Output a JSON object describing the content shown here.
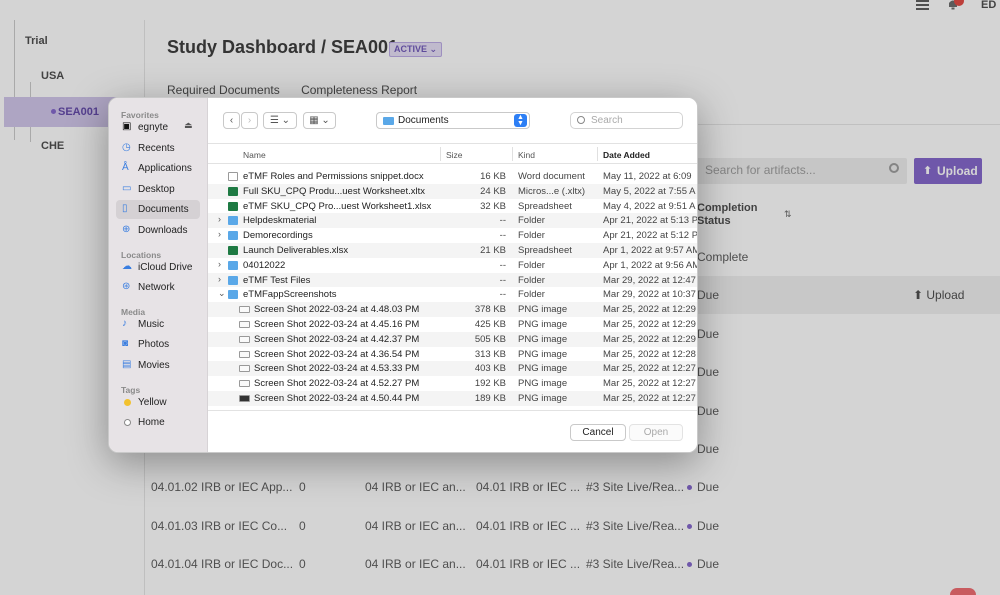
{
  "app": {
    "avatar": "ED",
    "title": "Study Dashboard / SEA001",
    "status": "ACTIVE",
    "tabs": [
      "Required Documents",
      "Completeness Report"
    ],
    "tree": {
      "root": "Trial",
      "country": "USA",
      "site": "SEA001",
      "other": "CHE"
    },
    "search_placeholder": "Search for artifacts...",
    "upload_label": "Upload",
    "column_header": "Completion Status",
    "rows": [
      {
        "status": "Complete",
        "kind": "ok"
      },
      {
        "status": "Due",
        "upload": "Upload",
        "highlight": true
      },
      {
        "status": "Due"
      },
      {
        "status": "Due"
      },
      {
        "status": "Due"
      },
      {
        "status": "Due"
      },
      {
        "c1": "04.01.02 IRB or IEC App...",
        "c2": "0",
        "c3": "04 IRB or IEC an...",
        "c4": "04.01 IRB or IEC ...",
        "c5": "#3 Site Live/Rea...",
        "status": "Due"
      },
      {
        "c1": "04.01.03 IRB or IEC Co...",
        "c2": "0",
        "c3": "04 IRB or IEC an...",
        "c4": "04.01 IRB or IEC ...",
        "c5": "#3 Site Live/Rea...",
        "status": "Due"
      },
      {
        "c1": "04.01.04 IRB or IEC Doc...",
        "c2": "0",
        "c3": "04 IRB or IEC an...",
        "c4": "04.01 IRB or IEC ...",
        "c5": "#3 Site Live/Rea...",
        "status": "Due"
      }
    ]
  },
  "dialog": {
    "sidebar": {
      "favorites_label": "Favorites",
      "favorites": [
        {
          "label": "egnyte",
          "icon": "drive-icon"
        },
        {
          "label": "Recents",
          "icon": "clock-icon"
        },
        {
          "label": "Applications",
          "icon": "apps-icon"
        },
        {
          "label": "Desktop",
          "icon": "desktop-icon"
        },
        {
          "label": "Documents",
          "icon": "document-icon",
          "active": true
        },
        {
          "label": "Downloads",
          "icon": "download-icon"
        }
      ],
      "locations_label": "Locations",
      "locations": [
        {
          "label": "iCloud Drive",
          "icon": "cloud-icon"
        },
        {
          "label": "Network",
          "icon": "globe-icon"
        }
      ],
      "media_label": "Media",
      "media": [
        {
          "label": "Music",
          "icon": "music-icon"
        },
        {
          "label": "Photos",
          "icon": "camera-icon"
        },
        {
          "label": "Movies",
          "icon": "film-icon"
        }
      ],
      "tags_label": "Tags",
      "tags": [
        {
          "label": "Yellow",
          "color": "#f2c12e"
        },
        {
          "label": "Home",
          "color": "#ffffff"
        }
      ]
    },
    "toolbar": {
      "back": "‹",
      "forward": "›",
      "list_view": "☰ ⌄",
      "grid_view": "▦ ⌄",
      "path": "Documents",
      "search_placeholder": "Search"
    },
    "columns": {
      "name": "Name",
      "size": "Size",
      "kind": "Kind",
      "date": "Date Added"
    },
    "files": [
      {
        "name": "eTMF Roles and Permissions snippet.docx",
        "size": "16 KB",
        "kind": "Word document",
        "date": "May 11, 2022 at 6:09",
        "icon": "doc"
      },
      {
        "name": "Full SKU_CPQ Produ...uest Worksheet.xltx",
        "size": "24 KB",
        "kind": "Micros...e (.xltx)",
        "date": "May 5, 2022 at 7:55 A",
        "icon": "xls"
      },
      {
        "name": "eTMF SKU_CPQ Pro...uest Worksheet1.xlsx",
        "size": "32 KB",
        "kind": "Spreadsheet",
        "date": "May 4, 2022 at 9:51 A",
        "icon": "xls"
      },
      {
        "name": "Helpdeskmaterial",
        "size": "--",
        "kind": "Folder",
        "date": "Apr 21, 2022 at 5:13 P",
        "icon": "folder",
        "disc": "›"
      },
      {
        "name": "Demorecordings",
        "size": "--",
        "kind": "Folder",
        "date": "Apr 21, 2022 at 5:12 P",
        "icon": "folder",
        "disc": "›"
      },
      {
        "name": "Launch Deliverables.xlsx",
        "size": "21 KB",
        "kind": "Spreadsheet",
        "date": "Apr 1, 2022 at 9:57 AM",
        "icon": "xls"
      },
      {
        "name": "04012022",
        "size": "--",
        "kind": "Folder",
        "date": "Apr 1, 2022 at 9:56 AM",
        "icon": "folder",
        "disc": "›"
      },
      {
        "name": "eTMF Test Files",
        "size": "--",
        "kind": "Folder",
        "date": "Mar 29, 2022 at 12:47",
        "icon": "folder",
        "disc": "›"
      },
      {
        "name": "eTMFappScreenshots",
        "size": "--",
        "kind": "Folder",
        "date": "Mar 29, 2022 at 10:37",
        "icon": "folder",
        "disc": "⌄"
      },
      {
        "name": "Screen Shot 2022-03-24 at 4.48.03 PM",
        "size": "378 KB",
        "kind": "PNG image",
        "date": "Mar 25, 2022 at 12:29",
        "icon": "png",
        "child": true
      },
      {
        "name": "Screen Shot 2022-03-24 at 4.45.16 PM",
        "size": "425 KB",
        "kind": "PNG image",
        "date": "Mar 25, 2022 at 12:29",
        "icon": "png",
        "child": true
      },
      {
        "name": "Screen Shot 2022-03-24 at 4.42.37 PM",
        "size": "505 KB",
        "kind": "PNG image",
        "date": "Mar 25, 2022 at 12:29",
        "icon": "png",
        "child": true
      },
      {
        "name": "Screen Shot 2022-03-24 at 4.36.54 PM",
        "size": "313 KB",
        "kind": "PNG image",
        "date": "Mar 25, 2022 at 12:28",
        "icon": "png",
        "child": true
      },
      {
        "name": "Screen Shot 2022-03-24 at 4.53.33 PM",
        "size": "403 KB",
        "kind": "PNG image",
        "date": "Mar 25, 2022 at 12:27",
        "icon": "png",
        "child": true
      },
      {
        "name": "Screen Shot 2022-03-24 at 4.52.27 PM",
        "size": "192 KB",
        "kind": "PNG image",
        "date": "Mar 25, 2022 at 12:27",
        "icon": "png",
        "child": true
      },
      {
        "name": "Screen Shot 2022-03-24 at 4.50.44 PM",
        "size": "189 KB",
        "kind": "PNG image",
        "date": "Mar 25, 2022 at 12:27",
        "icon": "png-dark",
        "child": true
      }
    ],
    "cancel_label": "Cancel",
    "open_label": "Open"
  }
}
